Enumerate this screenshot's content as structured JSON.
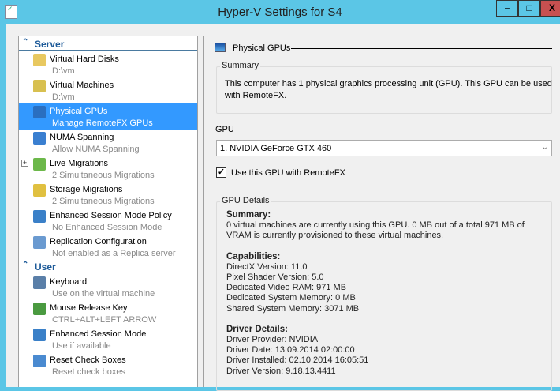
{
  "window": {
    "title": "Hyper-V Settings for S4",
    "minimize": "–",
    "maximize": "□",
    "close": "X"
  },
  "sidebar": {
    "sections": [
      {
        "label": "Server",
        "items": [
          {
            "label": "Virtual Hard Disks",
            "sub": "D:\\vm",
            "icon": "folder-disk-icon"
          },
          {
            "label": "Virtual Machines",
            "sub": "D:\\vm",
            "icon": "folder-server-icon"
          },
          {
            "label": "Physical GPUs",
            "sub": "Manage RemoteFX GPUs",
            "icon": "gpu-icon"
          },
          {
            "label": "NUMA Spanning",
            "sub": "Allow NUMA Spanning",
            "icon": "numa-icon"
          },
          {
            "label": "Live Migrations",
            "sub": "2 Simultaneous Migrations",
            "icon": "live-migration-icon"
          },
          {
            "label": "Storage Migrations",
            "sub": "2 Simultaneous Migrations",
            "icon": "storage-migration-icon"
          },
          {
            "label": "Enhanced Session Mode Policy",
            "sub": "No Enhanced Session Mode",
            "icon": "session-policy-icon"
          },
          {
            "label": "Replication Configuration",
            "sub": "Not enabled as a Replica server",
            "icon": "replication-icon"
          }
        ]
      },
      {
        "label": "User",
        "items": [
          {
            "label": "Keyboard",
            "sub": "Use on the virtual machine",
            "icon": "keyboard-icon"
          },
          {
            "label": "Mouse Release Key",
            "sub": "CTRL+ALT+LEFT ARROW",
            "icon": "mouse-release-icon"
          },
          {
            "label": "Enhanced Session Mode",
            "sub": "Use if available",
            "icon": "session-icon"
          },
          {
            "label": "Reset Check Boxes",
            "sub": "Reset check boxes",
            "icon": "reset-checkbox-icon"
          }
        ]
      }
    ],
    "expand_symbol": "+",
    "collapse_symbol": "⌃"
  },
  "panel": {
    "title": "Physical GPUs",
    "summary_label": "Summary",
    "summary_text": "This computer has 1 physical graphics processing unit (GPU). This GPU can be used with RemoteFX.",
    "gpu_label": "GPU",
    "gpu_selected": "1. NVIDIA GeForce GTX 460",
    "use_gpu_label": "Use this GPU with RemoteFX",
    "use_gpu_checked": true,
    "checkmark": "✓",
    "details_label": "GPU Details",
    "details": {
      "summary_head": "Summary:",
      "summary_l1": "0 virtual machines are currently using this GPU. 0 MB out of a total 971 MB of",
      "summary_l2": "VRAM is currently provisioned to these virtual machines.",
      "cap_head": "Capabilities:",
      "cap": [
        "DirectX Version: 11.0",
        "Pixel Shader Version: 5.0",
        "Dedicated Video RAM: 971 MB",
        "Dedicated System Memory: 0 MB",
        "Shared System Memory: 3071 MB"
      ],
      "drv_head": "Driver Details:",
      "drv": [
        "Driver Provider: NVIDIA",
        "Driver Date: 13.09.2014 02:00:00",
        "Driver Installed: 02.10.2014 16:05:51",
        "Driver Version: 9.18.13.4411"
      ]
    }
  }
}
